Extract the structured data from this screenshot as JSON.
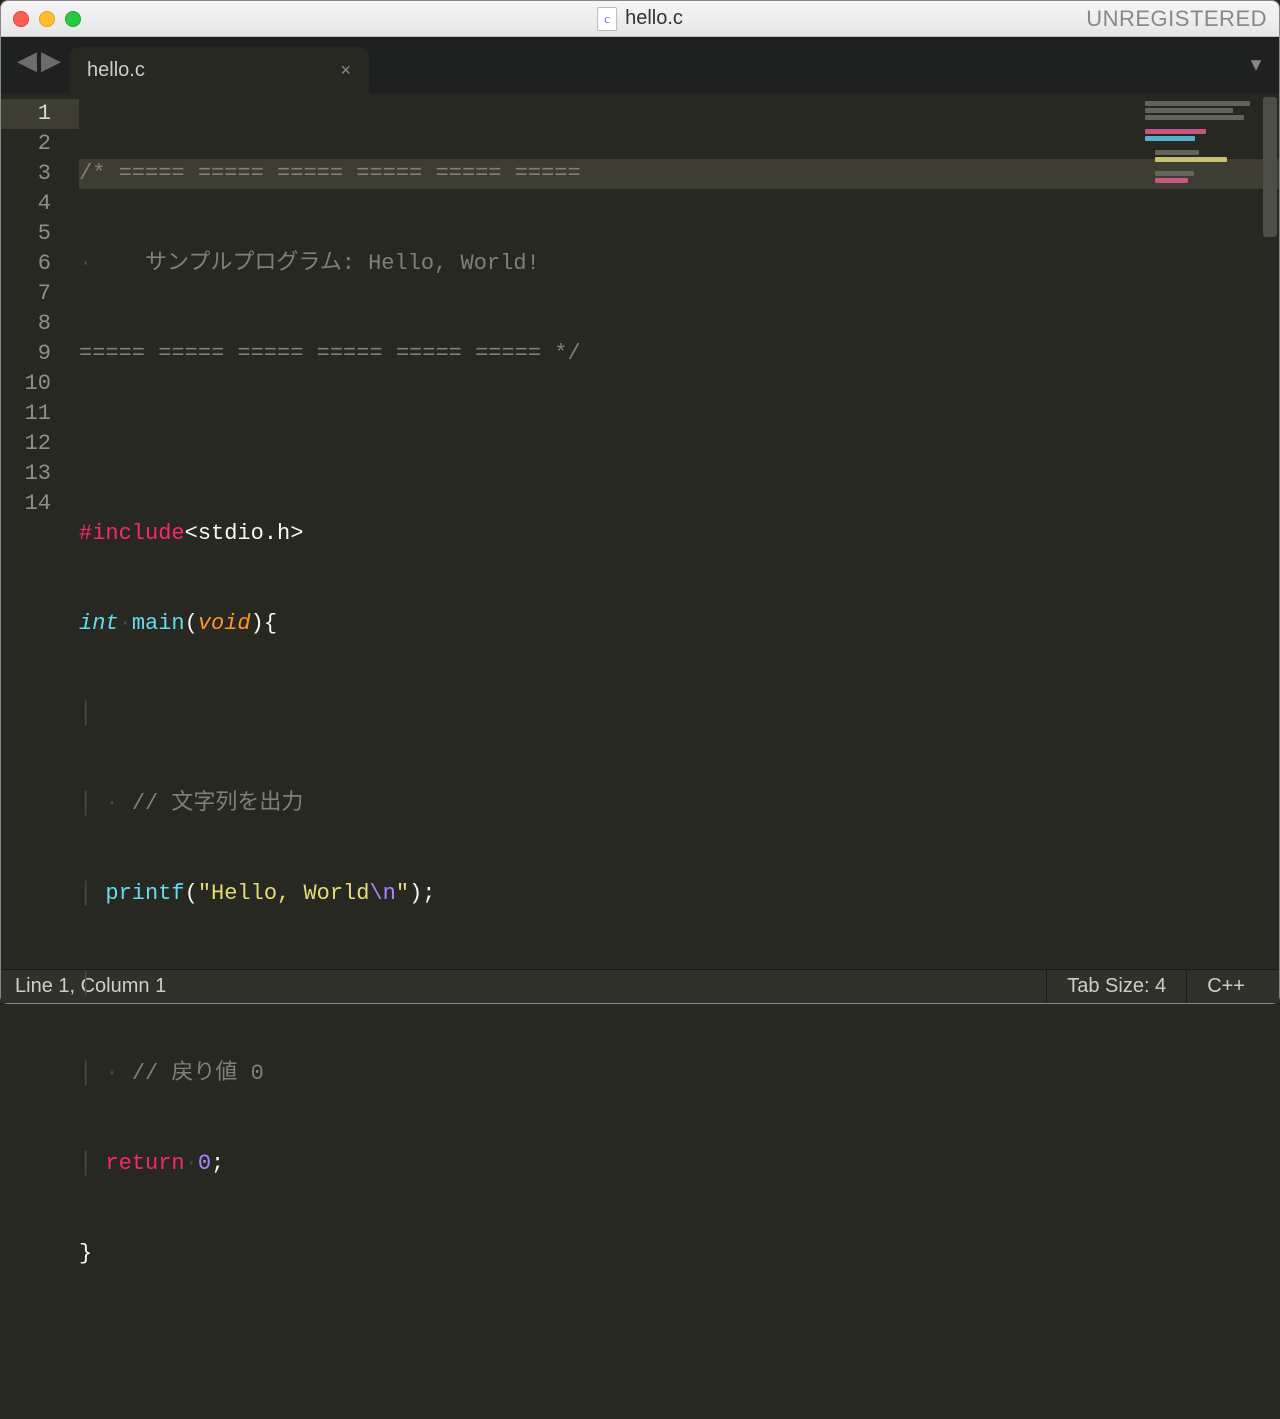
{
  "titlebar": {
    "file_icon_letter": "c",
    "filename": "hello.c",
    "unregistered": "UNREGISTERED"
  },
  "tab": {
    "label": "hello.c",
    "close_glyph": "×"
  },
  "nav": {
    "back": "◀",
    "forward": "▶",
    "menu": "▼"
  },
  "code": {
    "lines": {
      "l1_a": "/* ",
      "l1_b": "===== ===== ===== ===== ===== =====",
      "l2": "    サンプルプログラム: Hello, World!",
      "l3_a": "===== ===== ===== ===== ===== =====",
      "l3_b": " */",
      "l5_a": "#include",
      "l5_b": "<stdio.h>",
      "l6_int": "int",
      "l6_main": "main",
      "l6_void": "void",
      "l8": "// 文字列を出力",
      "l9_printf": "printf",
      "l9_str": "\"Hello, World",
      "l9_esc": "\\n",
      "l9_strend": "\"",
      "l11": "// 戻り値 0",
      "l12_return": "return",
      "l12_zero": "0"
    },
    "gutter": [
      "1",
      "2",
      "3",
      "4",
      "5",
      "6",
      "7",
      "8",
      "9",
      "10",
      "11",
      "12",
      "13",
      "14"
    ]
  },
  "status": {
    "position": "Line 1, Column 1",
    "tabsize": "Tab Size: 4",
    "syntax": "C++"
  }
}
